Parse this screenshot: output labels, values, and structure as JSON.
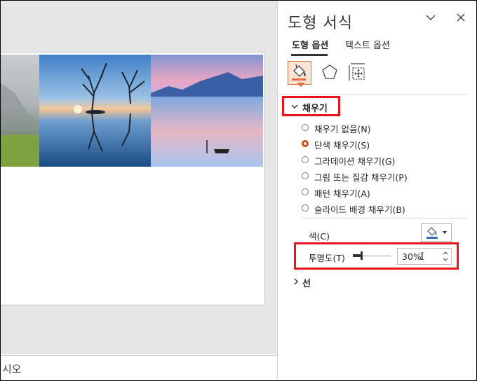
{
  "notes": {
    "text": "시오"
  },
  "pane": {
    "title": "도형 서식",
    "tabs": [
      {
        "label": "도형 옵션"
      },
      {
        "label": "텍스트 옵션"
      }
    ],
    "icons": [
      "fill-bucket-icon",
      "pentagon-icon",
      "size-properties-icon"
    ],
    "fill": {
      "header": "채우기",
      "options": [
        {
          "label": "채우기 없음(N)",
          "selected": false
        },
        {
          "label": "단색 채우기(S)",
          "selected": true
        },
        {
          "label": "그라데이션 채우기(G)",
          "selected": false
        },
        {
          "label": "그림 또는 질감 채우기(P)",
          "selected": false
        },
        {
          "label": "패턴 채우기(A)",
          "selected": false
        },
        {
          "label": "슬라이드 배경 채우기(B)",
          "selected": false
        }
      ],
      "color_label": "색(C)",
      "transparency_label": "투명도(T)",
      "transparency_value": "30%"
    },
    "line": {
      "header": "선"
    }
  },
  "colors": {
    "highlight": "#e8141c",
    "accent": "#d04a1a",
    "fill_color": "#2f6db5"
  }
}
